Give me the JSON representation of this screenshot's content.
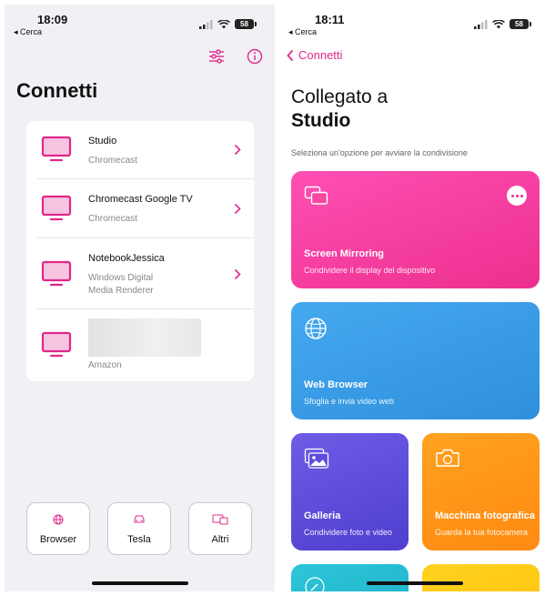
{
  "left": {
    "status": {
      "time": "18:09",
      "back_app": "◂ Cerca",
      "battery": "58"
    },
    "title": "Connetti",
    "devices": [
      {
        "name": "Studio",
        "type": "Chromecast"
      },
      {
        "name": "Chromecast Google TV",
        "type": "Chromecast"
      },
      {
        "name": "NotebookJessica",
        "type": "Windows Digital\nMedia Renderer"
      },
      {
        "name": "",
        "type": "Amazon"
      }
    ],
    "bottom_buttons": [
      {
        "label": "Browser",
        "icon": "globe-icon"
      },
      {
        "label": "Tesla",
        "icon": "car-icon"
      },
      {
        "label": "Altri",
        "icon": "cast-screens-icon"
      }
    ]
  },
  "right": {
    "status": {
      "time": "18:11",
      "back_app": "◂ Cerca",
      "battery": "58"
    },
    "back_label": "Connetti",
    "connected_to": "Collegato a",
    "device_name": "Studio",
    "subtitle": "Seleziona un'opzione per avviare la condivisione",
    "cards": [
      {
        "title": "Screen Mirroring",
        "subtitle": "Condividere il display del dispositivo",
        "color_start": "#ff4fb4",
        "color_end": "#ec2f8e"
      },
      {
        "title": "Web Browser",
        "subtitle": "Sfoglia e invia video web",
        "color_start": "#45a9ef",
        "color_end": "#2f8fdc"
      },
      {
        "title": "Galleria",
        "subtitle": "Condividere foto e video",
        "color_start": "#6e5ce6",
        "color_end": "#4f3fcf"
      },
      {
        "title": "Macchina fotografica",
        "subtitle": "Guarda la tua fotocamera",
        "color_start": "#ffa21f",
        "color_end": "#ff8a12"
      }
    ]
  },
  "colors": {
    "accent": "#e0288b",
    "tv_icon": "#e0288b"
  }
}
